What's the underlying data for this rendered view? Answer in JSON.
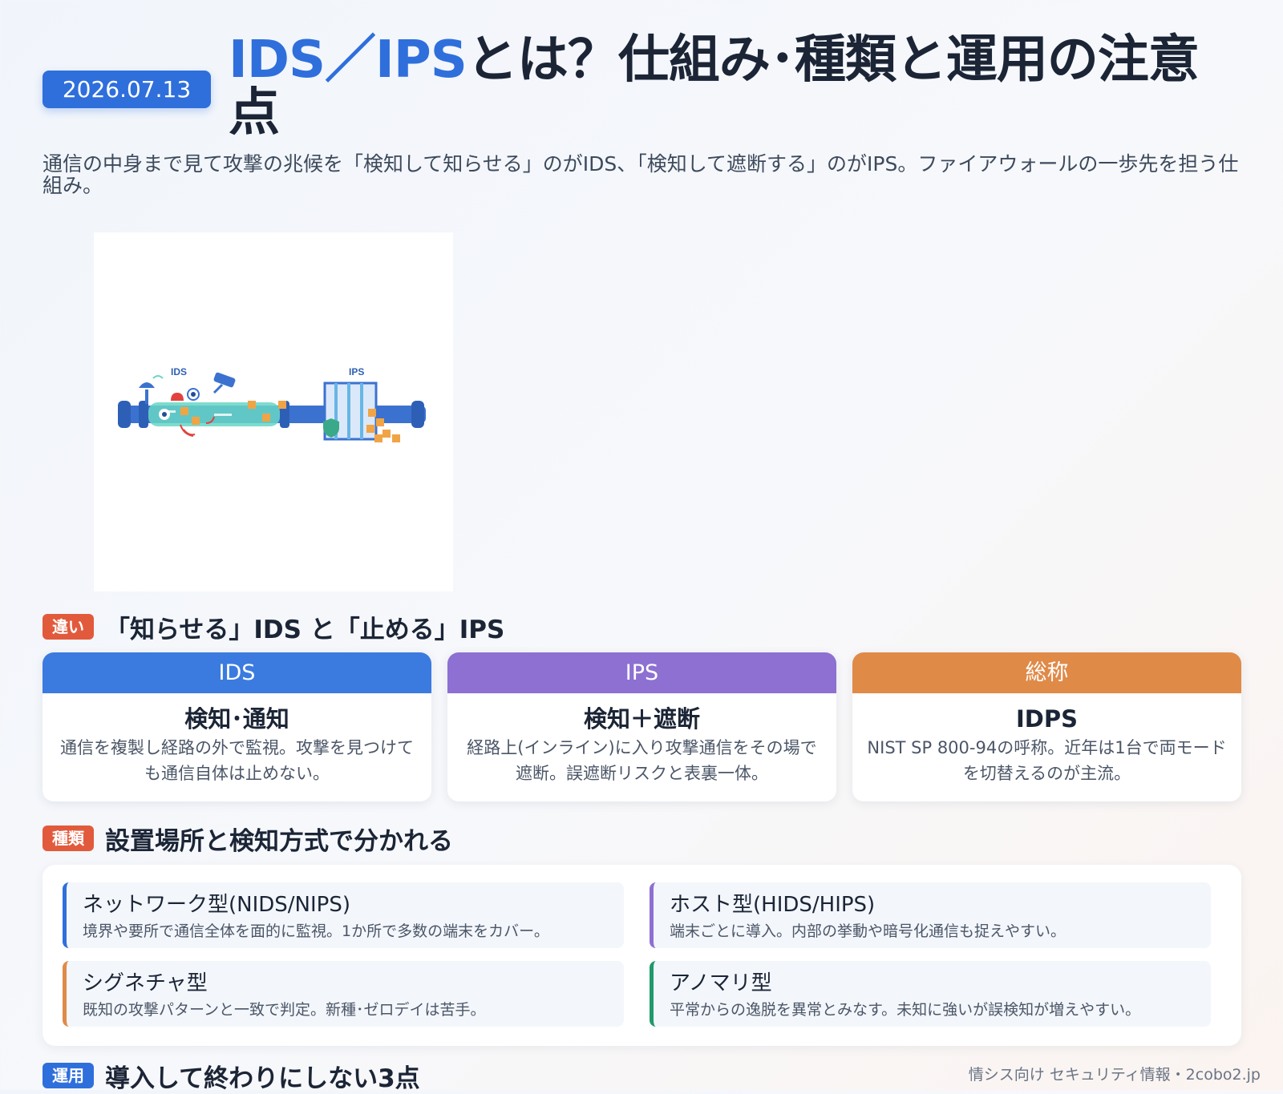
{
  "header": {
    "date": "2026.07.13",
    "title_accent": "IDS／IPS",
    "title_rest": "とは？仕組み･種類と運用の注意点",
    "lead": "通信の中身まで見て攻撃の兆候を「検知して知らせる」のがIDS、「検知して遮断する」のがIPS。ファイアウォールの一歩先を担う仕組み。"
  },
  "hero": {
    "ids_label": "IDS",
    "ips_label": "IPS"
  },
  "sections": [
    {
      "tag": "違い",
      "title": "「知らせる」IDS と「止める」IPS"
    },
    {
      "tag": "種類",
      "title": "設置場所と検知方式で分かれる"
    },
    {
      "tag": "運用",
      "title": "導入して終わりにしない3点"
    }
  ],
  "cards": [
    {
      "head": "IDS",
      "main": "検知･通知",
      "desc": "通信を複製し経路の外で監視。攻撃を見つけても通信自体は止めない。",
      "color": "#3b7be0"
    },
    {
      "head": "IPS",
      "main": "検知＋遮断",
      "desc": "経路上(インライン)に入り攻撃通信をその場で遮断。誤遮断リスクと表裏一体。",
      "color": "#8d70d2"
    },
    {
      "head": "総称",
      "main": "IDPS",
      "desc": "NIST SP 800-94の呼称。近年は1台で両モードを切替えるのが主流。",
      "color": "#e08a48"
    }
  ],
  "types": [
    {
      "title": "ネットワーク型(NIDS/NIPS)",
      "desc": "境界や要所で通信全体を面的に監視。1か所で多数の端末をカバー。",
      "color": "#2f6fdc"
    },
    {
      "title": "ホスト型(HIDS/HIPS)",
      "desc": "端末ごとに導入。内部の挙動や暗号化通信も捉えやすい。",
      "color": "#8d70d2"
    },
    {
      "title": "シグネチャ型",
      "desc": "既知の攻撃パターンと一致で判定。新種･ゼロデイは苦手。",
      "color": "#e08a48"
    },
    {
      "title": "アノマリ型",
      "desc": "平常からの逸脱を異常とみなす。未知に強いが誤検知が増えやすい。",
      "color": "#1f9a6a"
    }
  ],
  "footer": {
    "credit": "情シス向け セキュリティ情報・2cobo2.jp"
  }
}
